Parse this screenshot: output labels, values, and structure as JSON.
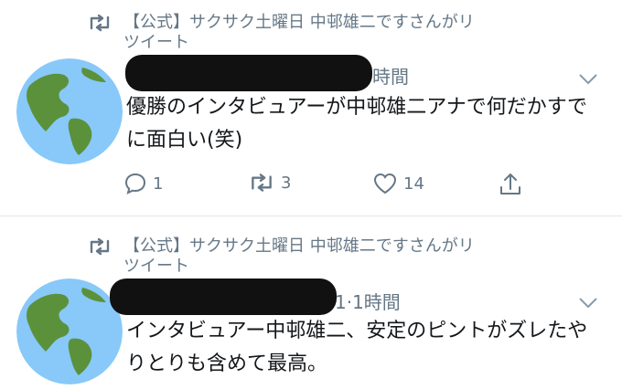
{
  "tweets": [
    {
      "retweet_label": "【公式】サクサク土曜日 中邨雄二ですさんがリツイート",
      "time": "時間",
      "text": "優勝のインタビュアーが中邨雄二アナで何だかすでに面白い(笑)",
      "actions": {
        "reply_count": "1",
        "retweet_count": "3",
        "like_count": "14"
      },
      "icons": {
        "retweet": "retweet-icon",
        "avatar": "globe-avatar",
        "caret": "chevron-down-icon",
        "reply": "reply-icon",
        "like": "heart-icon",
        "share": "share-icon"
      }
    },
    {
      "retweet_label": "【公式】サクサク土曜日 中邨雄二ですさんがリツイート",
      "time": "1·1時間",
      "text": "インタビュアー中邨雄二、安定のピントがズレたやりとりも含めて最高。"
    }
  ],
  "colors": {
    "text": "#14171a",
    "muted": "#657786",
    "divider": "#e1e8ed",
    "globe_ocean": "#88c9f9",
    "globe_land": "#5c913b"
  }
}
